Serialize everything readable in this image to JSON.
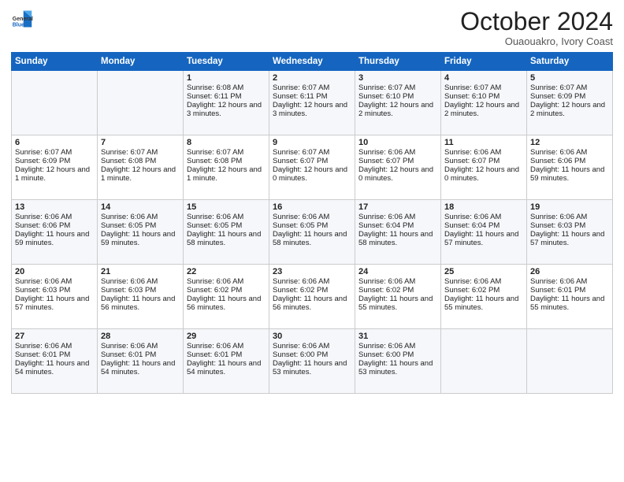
{
  "logo": {
    "general": "General",
    "blue": "Blue"
  },
  "title": "October 2024",
  "location": "Ouaouakro, Ivory Coast",
  "headers": [
    "Sunday",
    "Monday",
    "Tuesday",
    "Wednesday",
    "Thursday",
    "Friday",
    "Saturday"
  ],
  "weeks": [
    [
      {
        "day": "",
        "sunrise": "",
        "sunset": "",
        "daylight": ""
      },
      {
        "day": "",
        "sunrise": "",
        "sunset": "",
        "daylight": ""
      },
      {
        "day": "1",
        "sunrise": "Sunrise: 6:08 AM",
        "sunset": "Sunset: 6:11 PM",
        "daylight": "Daylight: 12 hours and 3 minutes."
      },
      {
        "day": "2",
        "sunrise": "Sunrise: 6:07 AM",
        "sunset": "Sunset: 6:11 PM",
        "daylight": "Daylight: 12 hours and 3 minutes."
      },
      {
        "day": "3",
        "sunrise": "Sunrise: 6:07 AM",
        "sunset": "Sunset: 6:10 PM",
        "daylight": "Daylight: 12 hours and 2 minutes."
      },
      {
        "day": "4",
        "sunrise": "Sunrise: 6:07 AM",
        "sunset": "Sunset: 6:10 PM",
        "daylight": "Daylight: 12 hours and 2 minutes."
      },
      {
        "day": "5",
        "sunrise": "Sunrise: 6:07 AM",
        "sunset": "Sunset: 6:09 PM",
        "daylight": "Daylight: 12 hours and 2 minutes."
      }
    ],
    [
      {
        "day": "6",
        "sunrise": "Sunrise: 6:07 AM",
        "sunset": "Sunset: 6:09 PM",
        "daylight": "Daylight: 12 hours and 1 minute."
      },
      {
        "day": "7",
        "sunrise": "Sunrise: 6:07 AM",
        "sunset": "Sunset: 6:08 PM",
        "daylight": "Daylight: 12 hours and 1 minute."
      },
      {
        "day": "8",
        "sunrise": "Sunrise: 6:07 AM",
        "sunset": "Sunset: 6:08 PM",
        "daylight": "Daylight: 12 hours and 1 minute."
      },
      {
        "day": "9",
        "sunrise": "Sunrise: 6:07 AM",
        "sunset": "Sunset: 6:07 PM",
        "daylight": "Daylight: 12 hours and 0 minutes."
      },
      {
        "day": "10",
        "sunrise": "Sunrise: 6:06 AM",
        "sunset": "Sunset: 6:07 PM",
        "daylight": "Daylight: 12 hours and 0 minutes."
      },
      {
        "day": "11",
        "sunrise": "Sunrise: 6:06 AM",
        "sunset": "Sunset: 6:07 PM",
        "daylight": "Daylight: 12 hours and 0 minutes."
      },
      {
        "day": "12",
        "sunrise": "Sunrise: 6:06 AM",
        "sunset": "Sunset: 6:06 PM",
        "daylight": "Daylight: 11 hours and 59 minutes."
      }
    ],
    [
      {
        "day": "13",
        "sunrise": "Sunrise: 6:06 AM",
        "sunset": "Sunset: 6:06 PM",
        "daylight": "Daylight: 11 hours and 59 minutes."
      },
      {
        "day": "14",
        "sunrise": "Sunrise: 6:06 AM",
        "sunset": "Sunset: 6:05 PM",
        "daylight": "Daylight: 11 hours and 59 minutes."
      },
      {
        "day": "15",
        "sunrise": "Sunrise: 6:06 AM",
        "sunset": "Sunset: 6:05 PM",
        "daylight": "Daylight: 11 hours and 58 minutes."
      },
      {
        "day": "16",
        "sunrise": "Sunrise: 6:06 AM",
        "sunset": "Sunset: 6:05 PM",
        "daylight": "Daylight: 11 hours and 58 minutes."
      },
      {
        "day": "17",
        "sunrise": "Sunrise: 6:06 AM",
        "sunset": "Sunset: 6:04 PM",
        "daylight": "Daylight: 11 hours and 58 minutes."
      },
      {
        "day": "18",
        "sunrise": "Sunrise: 6:06 AM",
        "sunset": "Sunset: 6:04 PM",
        "daylight": "Daylight: 11 hours and 57 minutes."
      },
      {
        "day": "19",
        "sunrise": "Sunrise: 6:06 AM",
        "sunset": "Sunset: 6:03 PM",
        "daylight": "Daylight: 11 hours and 57 minutes."
      }
    ],
    [
      {
        "day": "20",
        "sunrise": "Sunrise: 6:06 AM",
        "sunset": "Sunset: 6:03 PM",
        "daylight": "Daylight: 11 hours and 57 minutes."
      },
      {
        "day": "21",
        "sunrise": "Sunrise: 6:06 AM",
        "sunset": "Sunset: 6:03 PM",
        "daylight": "Daylight: 11 hours and 56 minutes."
      },
      {
        "day": "22",
        "sunrise": "Sunrise: 6:06 AM",
        "sunset": "Sunset: 6:02 PM",
        "daylight": "Daylight: 11 hours and 56 minutes."
      },
      {
        "day": "23",
        "sunrise": "Sunrise: 6:06 AM",
        "sunset": "Sunset: 6:02 PM",
        "daylight": "Daylight: 11 hours and 56 minutes."
      },
      {
        "day": "24",
        "sunrise": "Sunrise: 6:06 AM",
        "sunset": "Sunset: 6:02 PM",
        "daylight": "Daylight: 11 hours and 55 minutes."
      },
      {
        "day": "25",
        "sunrise": "Sunrise: 6:06 AM",
        "sunset": "Sunset: 6:02 PM",
        "daylight": "Daylight: 11 hours and 55 minutes."
      },
      {
        "day": "26",
        "sunrise": "Sunrise: 6:06 AM",
        "sunset": "Sunset: 6:01 PM",
        "daylight": "Daylight: 11 hours and 55 minutes."
      }
    ],
    [
      {
        "day": "27",
        "sunrise": "Sunrise: 6:06 AM",
        "sunset": "Sunset: 6:01 PM",
        "daylight": "Daylight: 11 hours and 54 minutes."
      },
      {
        "day": "28",
        "sunrise": "Sunrise: 6:06 AM",
        "sunset": "Sunset: 6:01 PM",
        "daylight": "Daylight: 11 hours and 54 minutes."
      },
      {
        "day": "29",
        "sunrise": "Sunrise: 6:06 AM",
        "sunset": "Sunset: 6:01 PM",
        "daylight": "Daylight: 11 hours and 54 minutes."
      },
      {
        "day": "30",
        "sunrise": "Sunrise: 6:06 AM",
        "sunset": "Sunset: 6:00 PM",
        "daylight": "Daylight: 11 hours and 53 minutes."
      },
      {
        "day": "31",
        "sunrise": "Sunrise: 6:06 AM",
        "sunset": "Sunset: 6:00 PM",
        "daylight": "Daylight: 11 hours and 53 minutes."
      },
      {
        "day": "",
        "sunrise": "",
        "sunset": "",
        "daylight": ""
      },
      {
        "day": "",
        "sunrise": "",
        "sunset": "",
        "daylight": ""
      }
    ]
  ]
}
